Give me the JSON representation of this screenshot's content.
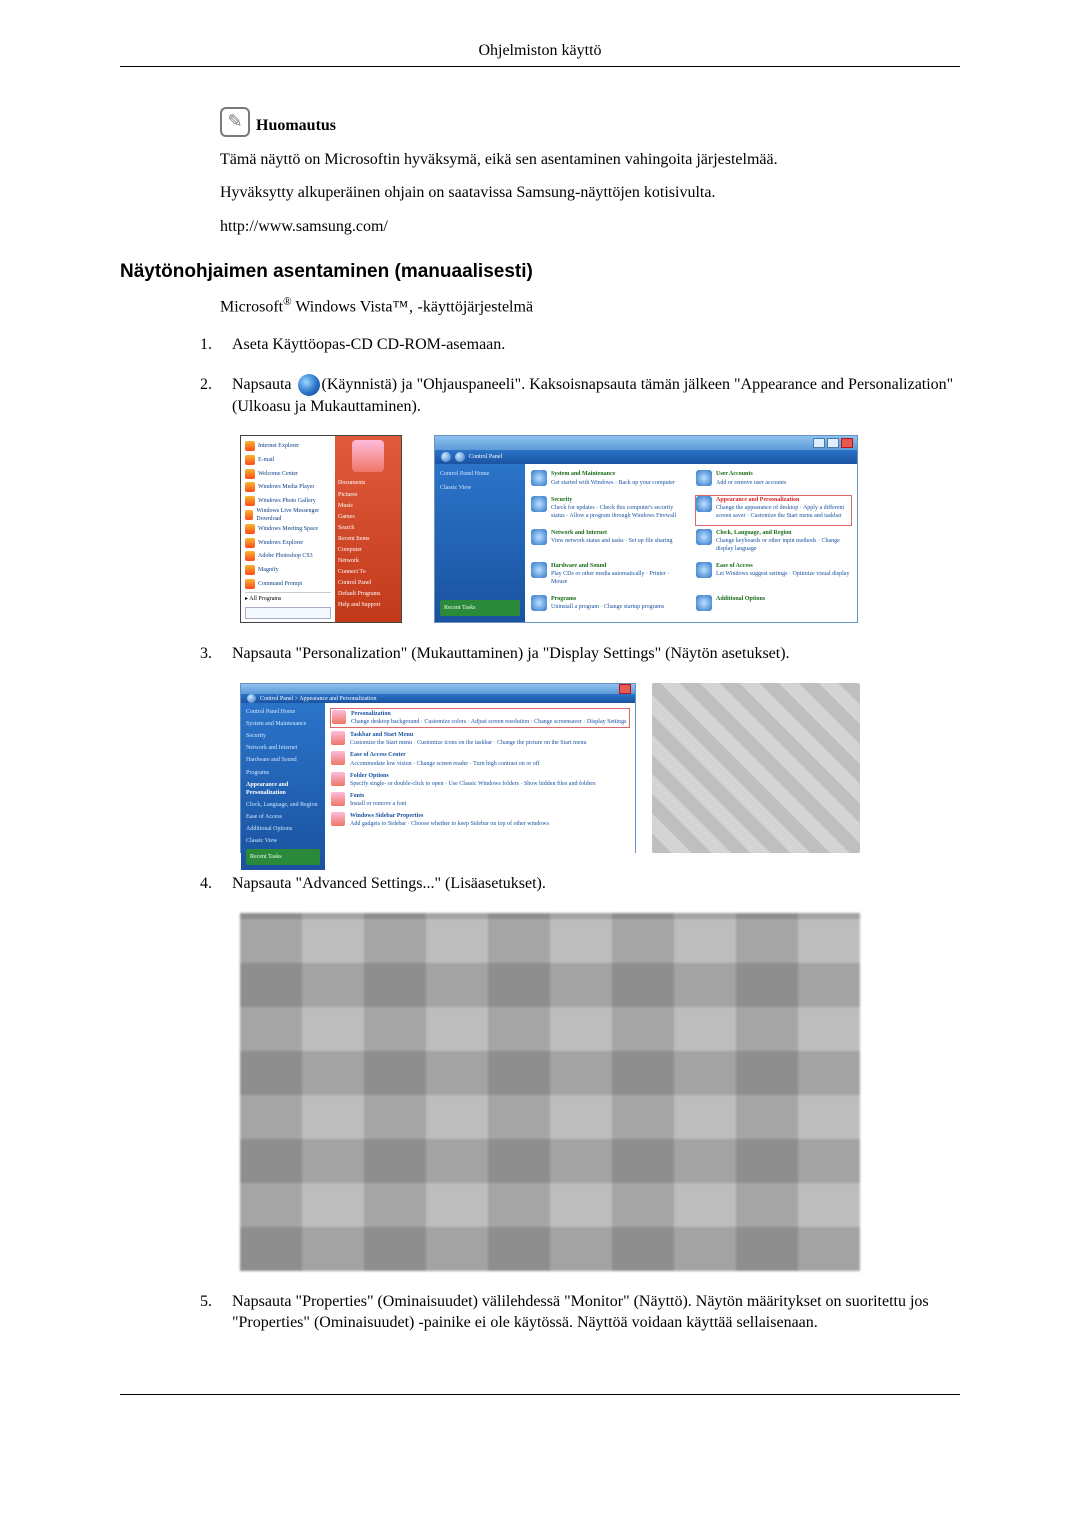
{
  "header": {
    "title": "Ohjelmiston käyttö"
  },
  "note": {
    "icon_name": "note-icon",
    "title": "Huomautus",
    "p1": "Tämä näyttö on Microsoftin hyväksymä, eikä sen asentaminen vahingoita järjestelmää.",
    "p2": "Hyväksytty alkuperäinen ohjain on saatavissa Samsung-näyttöjen kotisivulta.",
    "p3": "http://www.samsung.com/"
  },
  "section": {
    "heading": "Näytönohjaimen asentaminen (manuaalisesti)",
    "platform_prefix": "Microsoft",
    "platform_mid": " Windows Vista™‚ -käyttöjärjestelmä"
  },
  "steps": {
    "s1": {
      "num": "1.",
      "text": "Aseta Käyttöopas-CD CD-ROM-asemaan."
    },
    "s2": {
      "num": "2.",
      "text_a": "Napsauta ",
      "icon_name": "windows-start-icon",
      "text_b": "(Käynnistä) ja \"Ohjauspaneeli\". Kaksoisnapsauta tämän jälkeen \"Appearance and Personalization\" (Ulkoasu ja Mukauttaminen)."
    },
    "s3": {
      "num": "3.",
      "text": "Napsauta \"Personalization\" (Mukauttaminen) ja \"Display Settings\" (Näytön asetukset)."
    },
    "s4": {
      "num": "4.",
      "text": "Napsauta \"Advanced Settings...\" (Lisäasetukset)."
    },
    "s5": {
      "num": "5.",
      "text": "Napsauta \"Properties\" (Ominaisuudet) välilehdessä \"Monitor\" (Näyttö). Näytön määritykset on suoritettu jos \"Properties\" (Ominaisuudet) -painike ei ole käytössä. Näyttöä voidaan käyttää sellaisenaan."
    }
  },
  "fig1": {
    "start_apps": [
      "Internet Explorer",
      "E-mail",
      "Welcome Center",
      "Windows Media Player",
      "Windows Photo Gallery",
      "Windows Live Messenger Download",
      "Windows Meeting Space",
      "Windows Explorer",
      "Adobe Photoshop CS3",
      "Magnify",
      "Command Prompt"
    ],
    "start_allprograms": "All Programs",
    "start_right": [
      "Documents",
      "Pictures",
      "Music",
      "Games",
      "Search",
      "Recent Items",
      "Computer",
      "Network",
      "Connect To",
      "Control Panel",
      "Default Programs",
      "Help and Support"
    ],
    "cp_crumb": "Control Panel",
    "cp_side_links": [
      "Control Panel Home",
      "Classic View"
    ],
    "cp_side_recent": "Recent Tasks",
    "cp_cats_left": [
      {
        "h": "System and Maintenance",
        "s": "Get started with Windows · Back up your computer"
      },
      {
        "h": "Security",
        "s": "Check for updates · Check this computer's security status · Allow a program through Windows Firewall"
      },
      {
        "h": "Network and Internet",
        "s": "View network status and tasks · Set up file sharing"
      },
      {
        "h": "Hardware and Sound",
        "s": "Play CDs or other media automatically · Printer · Mouse"
      },
      {
        "h": "Programs",
        "s": "Uninstall a program · Change startup programs"
      }
    ],
    "cp_cats_right": [
      {
        "h": "User Accounts",
        "s": "Add or remove user accounts"
      },
      {
        "h": "Appearance and Personalization",
        "s": "Change the appearance of desktop · Apply a different screen saver · Customize the Start menu and taskbar"
      },
      {
        "h": "Clock, Language, and Region",
        "s": "Change keyboards or other input methods · Change display language"
      },
      {
        "h": "Ease of Access",
        "s": "Let Windows suggest settings · Optimize visual display"
      },
      {
        "h": "Additional Options",
        "s": ""
      }
    ]
  },
  "fig2": {
    "crumb": "Control Panel > Appearance and Personalization",
    "side": [
      "Control Panel Home",
      "System and Maintenance",
      "Security",
      "Network and Internet",
      "Hardware and Sound",
      "Programs",
      "Appearance and Personalization",
      "Clock, Language, and Region",
      "Ease of Access",
      "Additional Options",
      "Classic View"
    ],
    "recent": "Recent Tasks",
    "rows": [
      {
        "h": "Personalization",
        "s": "Change desktop background · Customize colors · Adjust screen resolution · Change screensaver · Display Settings"
      },
      {
        "h": "Taskbar and Start Menu",
        "s": "Customize the Start menu · Customize icons on the taskbar · Change the picture on the Start menu"
      },
      {
        "h": "Ease of Access Center",
        "s": "Accommodate low vision · Change screen reader · Turn high contrast on or off"
      },
      {
        "h": "Folder Options",
        "s": "Specify single- or double-click to open · Use Classic Windows folders · Show hidden files and folders"
      },
      {
        "h": "Fonts",
        "s": "Install or remove a font"
      },
      {
        "h": "Windows Sidebar Properties",
        "s": "Add gadgets to Sidebar · Choose whether to keep Sidebar on top of other windows"
      }
    ]
  }
}
